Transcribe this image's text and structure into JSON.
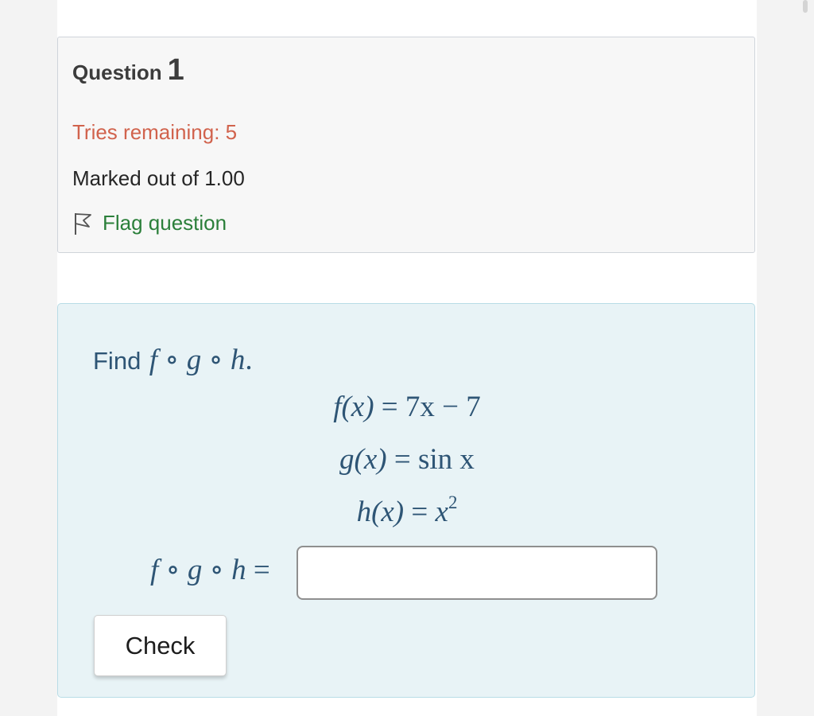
{
  "question": {
    "label": "Question",
    "number": "1",
    "tries_remaining": "Tries remaining: 5",
    "marked_out_of": "Marked out of 1.00",
    "flag_label": "Flag question"
  },
  "problem": {
    "prompt": "Find",
    "equations": {
      "f_lhs": "f(x)",
      "f_rhs": "7x − 7",
      "g_lhs": "g(x)",
      "g_rhs": "sin x",
      "h_lhs": "h(x)",
      "h_rhs_base": "x",
      "h_rhs_exp": "2"
    },
    "answer_value": "",
    "check_label": "Check"
  },
  "icons": {
    "flag": "flag-outline-icon"
  },
  "colors": {
    "tries": "#d1634d",
    "flag_link": "#2b7f3a",
    "math_text": "#2e5575",
    "content_bg": "#e8f3f6"
  }
}
